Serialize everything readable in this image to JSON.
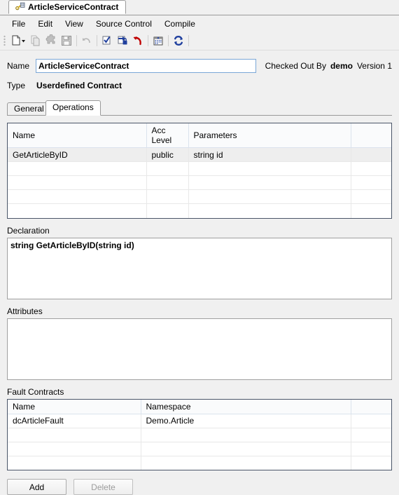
{
  "window": {
    "document_tab": "ArticleServiceContract",
    "tab_icon": "contract-key-icon"
  },
  "menubar": {
    "items": [
      {
        "label": "File",
        "name": "menu-file"
      },
      {
        "label": "Edit",
        "name": "menu-edit"
      },
      {
        "label": "View",
        "name": "menu-view"
      },
      {
        "label": "Source Control",
        "name": "menu-source-control"
      },
      {
        "label": "Compile",
        "name": "menu-compile"
      }
    ]
  },
  "toolbar": {
    "buttons": [
      {
        "icon": "new-document-icon",
        "enabled": true
      },
      {
        "icon": "dropdown-arrow-icon",
        "enabled": true
      },
      {
        "icon": "copy-icon",
        "enabled": false
      },
      {
        "icon": "plugin-puzzle-icon",
        "enabled": false
      },
      {
        "icon": "save-floppy-icon",
        "enabled": false
      },
      {
        "icon": "undo-arrow-icon",
        "enabled": false
      },
      {
        "icon": "check-out-icon",
        "enabled": true
      },
      {
        "icon": "check-in-lock-icon",
        "enabled": true
      },
      {
        "icon": "undo-checkout-icon",
        "enabled": true
      },
      {
        "icon": "calendar-history-icon",
        "enabled": true
      },
      {
        "icon": "refresh-sync-icon",
        "enabled": true
      }
    ]
  },
  "form": {
    "name_label": "Name",
    "name_value": "ArticleServiceContract",
    "name_placeholder": "",
    "checked_out_by_label": "Checked Out By",
    "checked_out_by_user": "demo",
    "version_label": "Version 1",
    "type_label": "Type",
    "type_value": "Userdefined Contract"
  },
  "tabs": [
    {
      "label": "General",
      "name": "tab-general",
      "active": false
    },
    {
      "label": "Operations",
      "name": "tab-operations",
      "active": true
    }
  ],
  "operations_grid": {
    "columns": [
      "Name",
      "Acc Level",
      "Parameters",
      ""
    ],
    "rows": [
      {
        "cells": [
          "GetArticleByID",
          "public",
          "string id",
          ""
        ],
        "selected": true
      },
      {
        "cells": [
          "",
          "",
          "",
          ""
        ],
        "selected": false
      },
      {
        "cells": [
          "",
          "",
          "",
          ""
        ],
        "selected": false
      },
      {
        "cells": [
          "",
          "",
          "",
          ""
        ],
        "selected": false
      },
      {
        "cells": [
          "",
          "",
          "",
          ""
        ],
        "selected": false
      }
    ]
  },
  "declaration": {
    "label": "Declaration",
    "value": "string GetArticleByID(string id)"
  },
  "attributes": {
    "label": "Attributes",
    "value": ""
  },
  "fault_contracts": {
    "label": "Fault Contracts",
    "columns": [
      "Name",
      "Namespace",
      ""
    ],
    "rows": [
      {
        "cells": [
          "dcArticleFault",
          "Demo.Article",
          ""
        ]
      },
      {
        "cells": [
          "",
          "",
          ""
        ]
      },
      {
        "cells": [
          "",
          "",
          ""
        ]
      },
      {
        "cells": [
          "",
          "",
          ""
        ]
      }
    ]
  },
  "actions": {
    "add_label": "Add",
    "delete_label": "Delete"
  },
  "colors": {
    "window_bg": "#f0f0f0",
    "field_border_focus": "#7ba7d7",
    "grid_border": "#4a5568",
    "accent_blue": "#1f3f9e",
    "accent_red": "#c00000",
    "selected_row": "#eeeeee"
  }
}
